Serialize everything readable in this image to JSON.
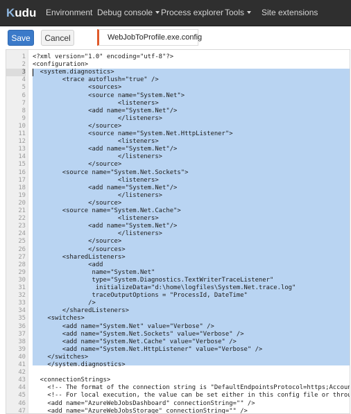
{
  "navbar": {
    "brand_mark": "K",
    "brand_text": "udu",
    "items": [
      {
        "label": "Environment",
        "dropdown": false
      },
      {
        "label": "Debug console",
        "dropdown": true
      },
      {
        "label": "Process explorer",
        "dropdown": false
      },
      {
        "label": "Tools",
        "dropdown": true
      },
      {
        "label": "Site extensions",
        "dropdown": false
      }
    ]
  },
  "toolbar": {
    "save_label": "Save",
    "cancel_label": "Cancel",
    "file_name": "WebJobToProfile.exe.config",
    "file_accent": "#e05a2b"
  },
  "editor": {
    "active_line": 3,
    "selection": {
      "from_line": 3,
      "to_line": 41
    },
    "lines": [
      "<?xml version=\"1.0\" encoding=\"utf-8\"?>",
      "<configuration>",
      "  <system.diagnostics>",
      "        <trace autoflush=\"true\" />",
      "               <sources>",
      "               <source name=\"System.Net\">",
      "                       <listeners>",
      "               <add name=\"System.Net\"/>",
      "                       </listeners>",
      "               </source>",
      "               <source name=\"System.Net.HttpListener\">",
      "                       <listeners>",
      "               <add name=\"System.Net\"/>",
      "                       </listeners>",
      "               </source>",
      "        <source name=\"System.Net.Sockets\">",
      "                       <listeners>",
      "               <add name=\"System.Net\"/>",
      "                       </listeners>",
      "               </source>",
      "        <source name=\"System.Net.Cache\">",
      "                       <listeners>",
      "               <add name=\"System.Net\"/>",
      "                       </listeners>",
      "               </source>",
      "               </sources>",
      "        <sharedListeners>",
      "               <add",
      "                name=\"System.Net\"",
      "                type=\"System.Diagnostics.TextWriterTraceListener\"",
      "                 initializeData=\"d:\\home\\logfiles\\System.Net.trace.log\"",
      "                traceOutputOptions = \"ProcessId, DateTime\"",
      "               />",
      "        </sharedListeners>",
      "    <switches>",
      "        <add name=\"System.Net\" value=\"Verbose\" />",
      "        <add name=\"System.Net.Sockets\" value=\"Verbose\" />",
      "        <add name=\"System.Net.Cache\" value=\"Verbose\" />",
      "        <add name=\"System.Net.HttpListener\" value=\"Verbose\" />",
      "    </switches>",
      "    </system.diagnostics>",
      "",
      "  <connectionStrings>",
      "    <!-- The format of the connection string is \"DefaultEndpointsProtocol=https;AccountName",
      "    <!-- For local execution, the value can be set either in this config file or through",
      "    <add name=\"AzureWebJobsDashboard\" connectionString=\"\" />",
      "    <add name=\"AzureWebJobsStorage\" connectionString=\"\" />"
    ]
  }
}
